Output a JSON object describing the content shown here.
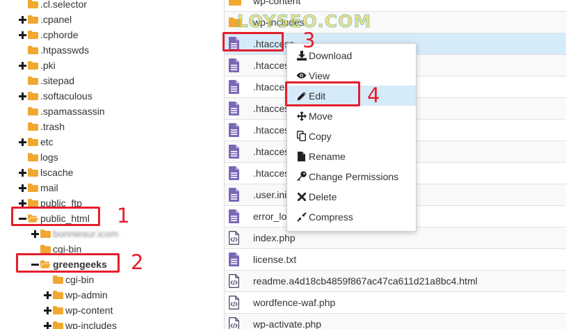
{
  "tree": [
    {
      "label": ".cl.selector",
      "expander": "none",
      "depth": 0
    },
    {
      "label": ".cpanel",
      "expander": "plus",
      "depth": 0
    },
    {
      "label": ".cphorde",
      "expander": "plus",
      "depth": 0
    },
    {
      "label": ".htpasswds",
      "expander": "none",
      "depth": 0
    },
    {
      "label": ".pki",
      "expander": "plus",
      "depth": 0
    },
    {
      "label": ".sitepad",
      "expander": "none",
      "depth": 0
    },
    {
      "label": ".softaculous",
      "expander": "plus",
      "depth": 0
    },
    {
      "label": ".spamassassin",
      "expander": "none",
      "depth": 0
    },
    {
      "label": ".trash",
      "expander": "none",
      "depth": 0
    },
    {
      "label": "etc",
      "expander": "plus",
      "depth": 0
    },
    {
      "label": "logs",
      "expander": "none",
      "depth": 0
    },
    {
      "label": "lscache",
      "expander": "plus",
      "depth": 0
    },
    {
      "label": "mail",
      "expander": "plus",
      "depth": 0
    },
    {
      "label": "public_ftp",
      "expander": "plus",
      "depth": 0
    },
    {
      "label": "public_html",
      "expander": "minus",
      "depth": 0,
      "open": true
    },
    {
      "label": "bonniesur.icom",
      "expander": "plus",
      "depth": 1,
      "blurred": true
    },
    {
      "label": "cgi-bin",
      "expander": "none",
      "depth": 1
    },
    {
      "label": "greengeeks",
      "expander": "minus",
      "depth": 1,
      "open": true,
      "bold": true
    },
    {
      "label": "cgi-bin",
      "expander": "none",
      "depth": 2
    },
    {
      "label": "wp-admin",
      "expander": "plus",
      "depth": 2
    },
    {
      "label": "wp-content",
      "expander": "plus",
      "depth": 2
    },
    {
      "label": "wp-includes",
      "expander": "plus",
      "depth": 2
    }
  ],
  "files": [
    {
      "name": "wp-content",
      "icon": "folder-icon"
    },
    {
      "name": "wp-includes",
      "icon": "folder-icon"
    },
    {
      "name": ".htaccess",
      "icon": "text-file-icon",
      "selected": true
    },
    {
      "name": ".htaccess",
      "icon": "text-file-icon"
    },
    {
      "name": ".htaccess",
      "icon": "text-file-icon"
    },
    {
      "name": ".htaccess",
      "icon": "text-file-icon"
    },
    {
      "name": ".htaccess",
      "icon": "text-file-icon"
    },
    {
      "name": ".htaccess",
      "icon": "text-file-icon"
    },
    {
      "name": ".htaccess",
      "icon": "text-file-icon"
    },
    {
      "name": ".user.ini",
      "icon": "text-file-icon"
    },
    {
      "name": "error_log",
      "icon": "text-file-icon"
    },
    {
      "name": "index.php",
      "icon": "code-file-icon"
    },
    {
      "name": "license.txt",
      "icon": "text-file-icon"
    },
    {
      "name": "readme.a4d18cb4859f867ac47ca611d21a8bc4.html",
      "icon": "code-file-icon"
    },
    {
      "name": "wordfence-waf.php",
      "icon": "code-file-icon"
    },
    {
      "name": "wp-activate.php",
      "icon": "code-file-icon"
    }
  ],
  "context_menu": [
    {
      "label": "Download",
      "icon": "download-icon"
    },
    {
      "label": "View",
      "icon": "eye-icon"
    },
    {
      "label": "Edit",
      "icon": "pencil-icon",
      "hover": true
    },
    {
      "label": "Move",
      "icon": "move-arrows-icon"
    },
    {
      "label": "Copy",
      "icon": "copy-icon"
    },
    {
      "label": "Rename",
      "icon": "file-icon"
    },
    {
      "label": "Change Permissions",
      "icon": "key-icon"
    },
    {
      "label": "Delete",
      "icon": "x-icon"
    },
    {
      "label": "Compress",
      "icon": "compress-icon"
    }
  ],
  "annotations": [
    "1",
    "2",
    "3",
    "4"
  ],
  "watermark": "LOYSEO.COM",
  "colors": {
    "folder": "#f0a830",
    "file_icon": "#7b68b5",
    "selection": "#d6ebfa",
    "annotation": "#e41e2b"
  }
}
